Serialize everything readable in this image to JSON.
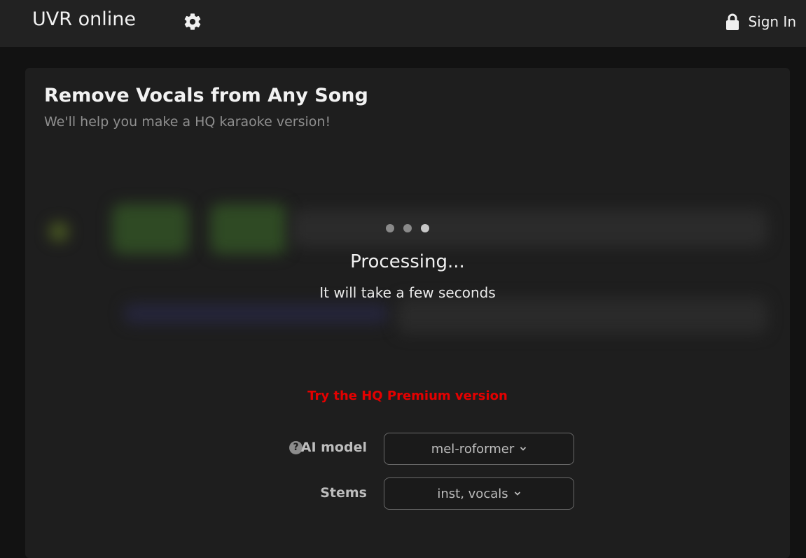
{
  "header": {
    "brand": "UVR online",
    "settings_icon": "gear-icon",
    "sign_in_icon": "lock-icon",
    "sign_in_label": "Sign In"
  },
  "main": {
    "title": "Remove Vocals from Any Song",
    "subtitle": "We'll help you make a HQ karaoke version!",
    "status": {
      "title": "Processing...",
      "subtitle": "It will take a few seconds",
      "dots_total": 3,
      "dots_active_index": 2
    },
    "premium_link": "Try the HQ Premium version",
    "options": {
      "model_label": "AI model",
      "model_help_icon": "help-icon",
      "model_value": "mel-roformer",
      "stems_label": "Stems",
      "stems_value": "inst, vocals"
    }
  },
  "colors": {
    "background": "#121212",
    "header": "#222222",
    "card": "#1e1e1e",
    "accent_red": "#e40000"
  }
}
